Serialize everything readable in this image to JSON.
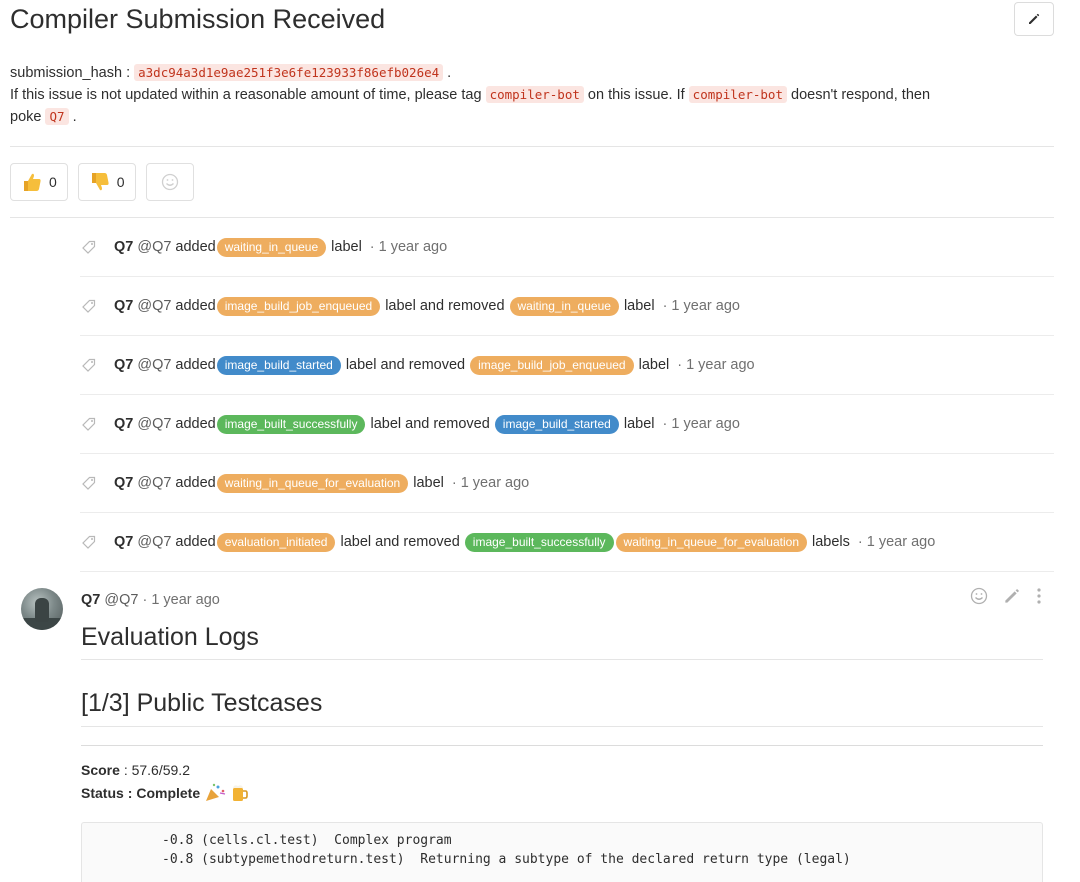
{
  "issue": {
    "title": "Compiler Submission Received",
    "hash_label": "submission_hash :",
    "hash_value": "a3dc94a3d1e9ae251f3e6fe123933f86efb026e4",
    "line2_a": "If this issue is not updated within a reasonable amount of time, please tag",
    "bot_tag": "compiler-bot",
    "line2_b": "on this issue. If",
    "line2_c": "doesn't respond, then",
    "line3_a": "poke",
    "poke_tag": "Q7"
  },
  "awards": {
    "thumbs_up_count": "0",
    "thumbs_down_count": "0"
  },
  "notes": [
    {
      "author": "Q7",
      "handle": "@Q7",
      "verb": "added",
      "added": [
        "waiting_in_queue"
      ],
      "removed_text": "",
      "removed": [],
      "suffix": "label",
      "time": "· 1 year ago"
    },
    {
      "author": "Q7",
      "handle": "@Q7",
      "verb": "added",
      "added": [
        "image_build_job_enqueued"
      ],
      "removed_text": "label and removed",
      "removed": [
        "waiting_in_queue"
      ],
      "suffix": "label",
      "time": "· 1 year ago"
    },
    {
      "author": "Q7",
      "handle": "@Q7",
      "verb": "added",
      "added": [
        "image_build_started"
      ],
      "removed_text": "label and removed",
      "removed": [
        "image_build_job_enqueued"
      ],
      "suffix": "label",
      "time": "· 1 year ago"
    },
    {
      "author": "Q7",
      "handle": "@Q7",
      "verb": "added",
      "added": [
        "image_built_successfully"
      ],
      "removed_text": "label and removed",
      "removed": [
        "image_build_started"
      ],
      "suffix": "label",
      "time": "· 1 year ago"
    },
    {
      "author": "Q7",
      "handle": "@Q7",
      "verb": "added",
      "added": [
        "waiting_in_queue_for_evaluation"
      ],
      "removed_text": "",
      "removed": [],
      "suffix": "label",
      "time": "· 1 year ago"
    },
    {
      "author": "Q7",
      "handle": "@Q7",
      "verb": "added",
      "added": [
        "evaluation_initiated"
      ],
      "removed_text": "label and removed",
      "removed": [
        "image_built_successfully",
        "waiting_in_queue_for_evaluation"
      ],
      "suffix": "labels",
      "time": "· 1 year ago"
    }
  ],
  "label_colors": {
    "waiting_in_queue": "#eead5f",
    "image_build_job_enqueued": "#eead5f",
    "image_build_started": "#428bca",
    "image_built_successfully": "#5cb85c",
    "waiting_in_queue_for_evaluation": "#eead5f",
    "evaluation_initiated": "#eead5f"
  },
  "comment": {
    "author": "Q7",
    "handle": "@Q7",
    "time": "· 1 year ago",
    "heading": "Evaluation Logs",
    "subheading": "[1/3] Public Testcases",
    "score_label": "Score",
    "score_value": ": 57.6/59.2",
    "status_label": "Status",
    "status_value": ": Complete",
    "log_lines": [
      "-0.8 (cells.cl.test)  Complex program",
      "-0.8 (subtypemethodreturn.test)  Returning a subtype of the declared return type (legal)"
    ]
  }
}
